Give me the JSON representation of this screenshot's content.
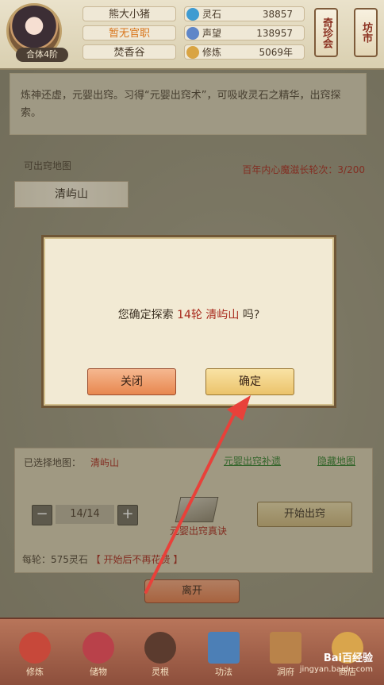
{
  "header": {
    "rank": "合体4阶",
    "player_name": "熊大小猪",
    "official_title": "暂无官职",
    "sect": "焚香谷",
    "stats": [
      {
        "label": "灵石",
        "value": "38857",
        "icon": "spirit-stone-icon",
        "color": "#3f9bd1"
      },
      {
        "label": "声望",
        "value": "138957",
        "icon": "prestige-icon",
        "color": "#5f86c8"
      },
      {
        "label": "修炼",
        "value": "5069年",
        "icon": "cultivation-icon",
        "color": "#d9a443"
      }
    ],
    "right_buttons": [
      "奇珍会",
      "坊市"
    ]
  },
  "main": {
    "description": "炼神还虚，元婴出窍。习得“元婴出窍术”，可吸收灵石之精华，出窍探索。",
    "map_section_label": "可出窍地图",
    "counter_text": "百年内心魔滋长轮次：3/200",
    "map_tag": "清屿山",
    "selected_label": "已选择地图：",
    "selected_value": "清屿山",
    "link_left": "元婴出窍补遗",
    "link_right": "隐藏地图",
    "stepper_value": "14/14",
    "book_label": "元婴出窍真诀",
    "start_button": "开始出窍",
    "cost_prefix": "每轮：575灵石",
    "cost_note": "【 开始后不再花费 】",
    "leave_button": "离开"
  },
  "dialog": {
    "msg_prefix": "您确定探索",
    "msg_highlight": "14轮 清屿山",
    "msg_suffix": "吗?",
    "close_button": "关闭",
    "confirm_button": "确定"
  },
  "nav": {
    "items": [
      {
        "label": "修炼",
        "icon": "cultivation-nav-icon",
        "color": "#c7483a"
      },
      {
        "label": "储物",
        "icon": "storage-bag-icon",
        "color": "#b9414a"
      },
      {
        "label": "灵根",
        "icon": "spirit-root-icon",
        "color": "#5b3b2e"
      },
      {
        "label": "功法",
        "icon": "skill-book-icon",
        "color": "#4c7fb6"
      },
      {
        "label": "洞府",
        "icon": "cave-house-icon",
        "color": "#b9834a"
      },
      {
        "label": "商店",
        "icon": "shop-icon",
        "color": "#d9a54c"
      }
    ]
  },
  "watermark": {
    "brand": "Bai百经验",
    "url": "jingyan.baidu.com"
  }
}
